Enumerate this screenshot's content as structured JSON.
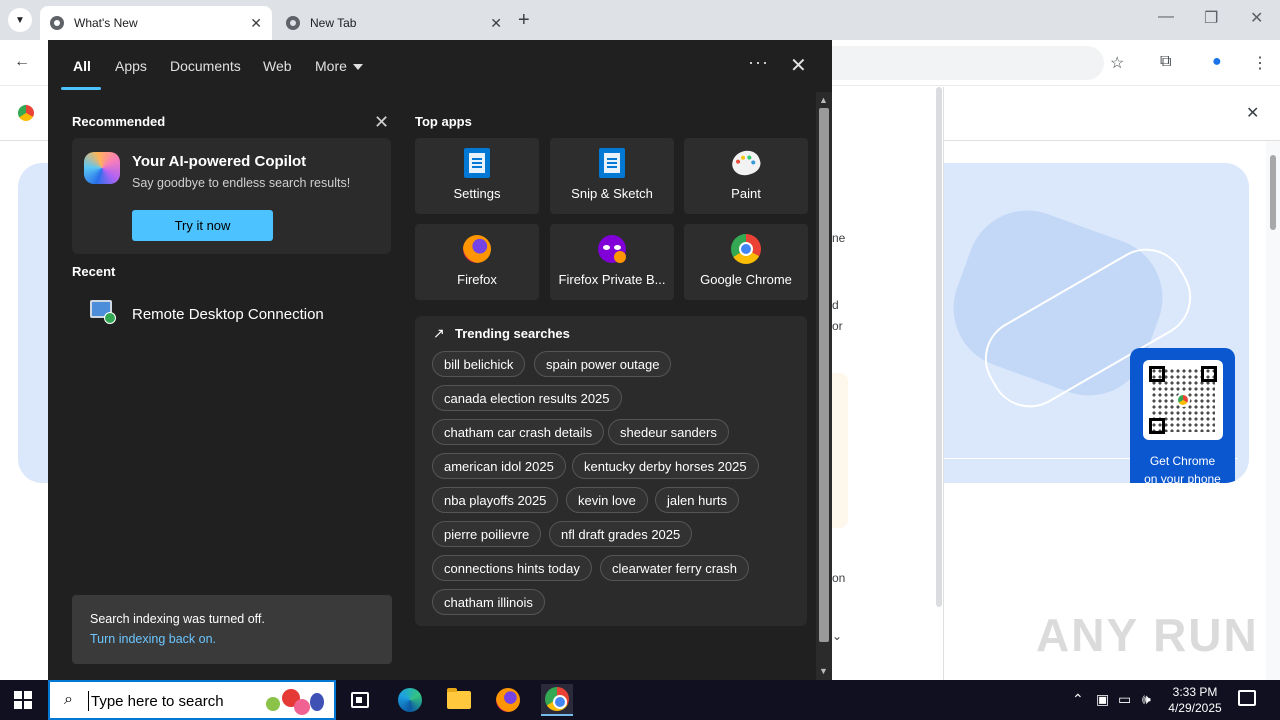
{
  "browser": {
    "tabs": [
      {
        "title": "What's New"
      },
      {
        "title": "New Tab"
      }
    ],
    "new_tab_symbol": "+",
    "close_symbol": "✕"
  },
  "page": {
    "qr_caption": "Get Chrome\non your phone",
    "fragments": [
      "ne",
      "d",
      "or",
      "on"
    ],
    "watermark": "ANY RUN"
  },
  "search": {
    "filters": [
      "All",
      "Apps",
      "Documents",
      "Web",
      "More"
    ],
    "options_symbol": "···",
    "recommended": {
      "title": "Recommended",
      "copilot_title": "Your AI-powered Copilot",
      "copilot_sub": "Say goodbye to endless search results!",
      "copilot_button": "Try it now"
    },
    "recent": {
      "title": "Recent",
      "items": [
        "Remote Desktop Connection"
      ]
    },
    "indexing": {
      "message": "Search indexing was turned off.",
      "link": "Turn indexing back on."
    },
    "top_apps": {
      "title": "Top apps",
      "apps": [
        "Settings",
        "Snip & Sketch",
        "Paint",
        "Firefox",
        "Firefox Private B...",
        "Google Chrome"
      ]
    },
    "trending": {
      "title": "Trending searches",
      "items": [
        "bill belichick",
        "spain power outage",
        "canada election results 2025",
        "chatham car crash details",
        "shedeur sanders",
        "american idol 2025",
        "kentucky derby horses 2025",
        "nba playoffs 2025",
        "kevin love",
        "jalen hurts",
        "pierre poilievre",
        "nfl draft grades 2025",
        "connections hints today",
        "clearwater ferry crash",
        "chatham illinois"
      ]
    }
  },
  "taskbar": {
    "search_placeholder": "Type here to search",
    "time": "3:33 PM",
    "date": "4/29/2025"
  },
  "colors": {
    "accent": "#4cc2ff",
    "panel_bg": "#202020",
    "taskbar_bg": "#101020",
    "chrome_blue": "#0b57d0"
  }
}
